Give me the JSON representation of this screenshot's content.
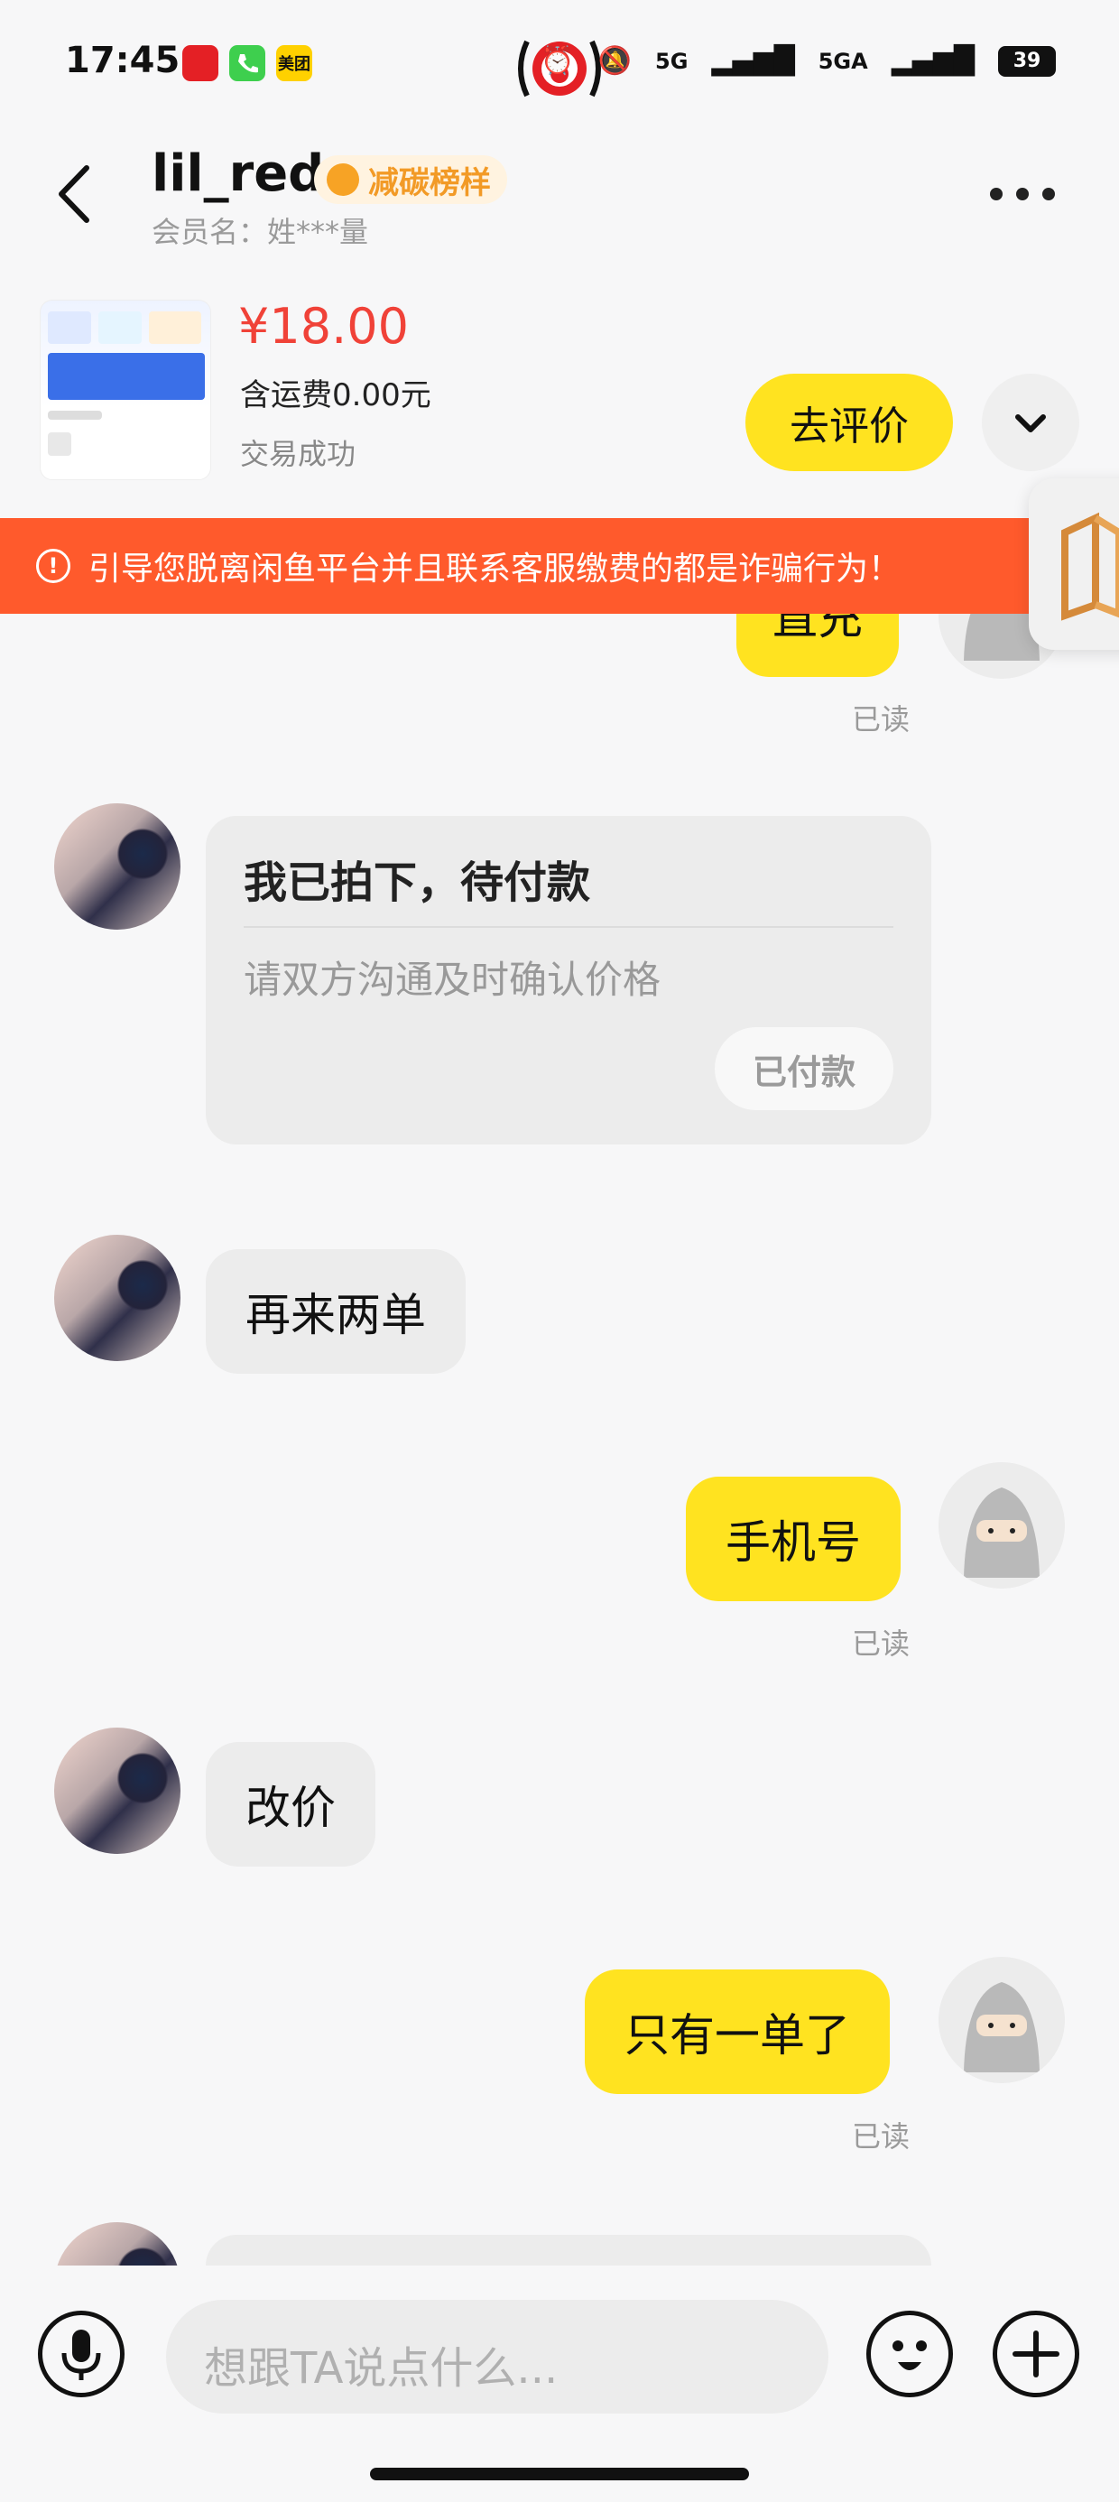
{
  "status_bar": {
    "time": "17:45",
    "app_icons": [
      "unionpay-icon",
      "phone-icon",
      "meituan-icon"
    ],
    "meituan_label": "美团",
    "network_1": "5G",
    "network_2": "5GA",
    "battery": "39"
  },
  "header": {
    "username": "lil_red",
    "badge": "减碳榜样",
    "member_name": "会员名：姓***量"
  },
  "product": {
    "price": "¥18.00",
    "shipping": "含运费0.00元",
    "status": "交易成功",
    "review_button": "去评价"
  },
  "warning": {
    "text": "引导您脱离闲鱼平台并且联系客服缴费的都是诈骗行为！"
  },
  "messages": {
    "m0_partial": "直充",
    "read_label": "已读",
    "order_card": {
      "title": "我已拍下，待付款",
      "subtitle": "请双方沟通及时确认价格",
      "button": "已付款"
    },
    "m1": "再来两单",
    "m2": "手机号",
    "m3": "改价",
    "m4": "只有一单了"
  },
  "input": {
    "placeholder": "想跟TA说点什么..."
  },
  "colors": {
    "accent_yellow": "#ffe320",
    "price_red": "#f04238",
    "warning_orange": "#ff5a2c",
    "badge_orange": "#f29a26"
  }
}
